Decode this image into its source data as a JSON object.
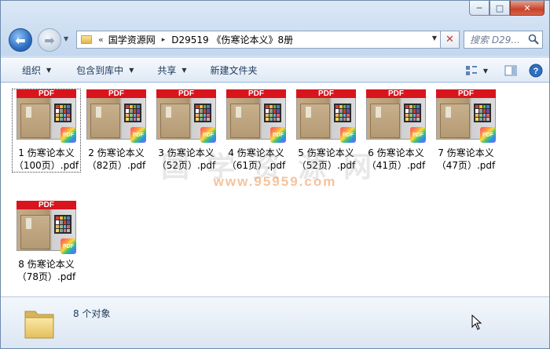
{
  "window": {
    "min_glyph": "─",
    "max_glyph": "□",
    "close_glyph": "✕"
  },
  "nav": {
    "back_glyph": "⬅",
    "forward_glyph": "➡",
    "history_glyph": "▼"
  },
  "address": {
    "chev": "«",
    "crumbs": [
      "国学资源网",
      "D29519 《伤寒论本义》8册"
    ],
    "sep": "▸",
    "drop": "▼",
    "stop": "✕"
  },
  "search": {
    "placeholder": "搜索 D29..."
  },
  "toolbar": {
    "items": [
      {
        "label": "组织",
        "has_caret": true
      },
      {
        "label": "包含到库中",
        "has_caret": true
      },
      {
        "label": "共享",
        "has_caret": true
      },
      {
        "label": "新建文件夹",
        "has_caret": false
      }
    ],
    "caret": "▼",
    "view_caret": "▼"
  },
  "thumb": {
    "band_text": "PDF",
    "badge_text": "PDF"
  },
  "files": [
    {
      "name": "1 伤寒论本义（100页）.pdf",
      "selected": true
    },
    {
      "name": "2 伤寒论本义（82页）.pdf",
      "selected": false
    },
    {
      "name": "3 伤寒论本义（52页）.pdf",
      "selected": false
    },
    {
      "name": "4 伤寒论本义（61页）.pdf",
      "selected": false
    },
    {
      "name": "5 伤寒论本义（52页）.pdf",
      "selected": false
    },
    {
      "name": "6 伤寒论本义（41页）.pdf",
      "selected": false
    },
    {
      "name": "7 伤寒论本义（47页）.pdf",
      "selected": false
    },
    {
      "name": "8 伤寒论本义（78页）.pdf",
      "selected": false
    }
  ],
  "watermark": {
    "text": "国学资源网",
    "number": "www.95959.com"
  },
  "status": {
    "count": "8 个对象"
  },
  "colors": {
    "pdf_band": "#d8141d",
    "accent": "#2e6fc2",
    "text": "#1e395b"
  }
}
